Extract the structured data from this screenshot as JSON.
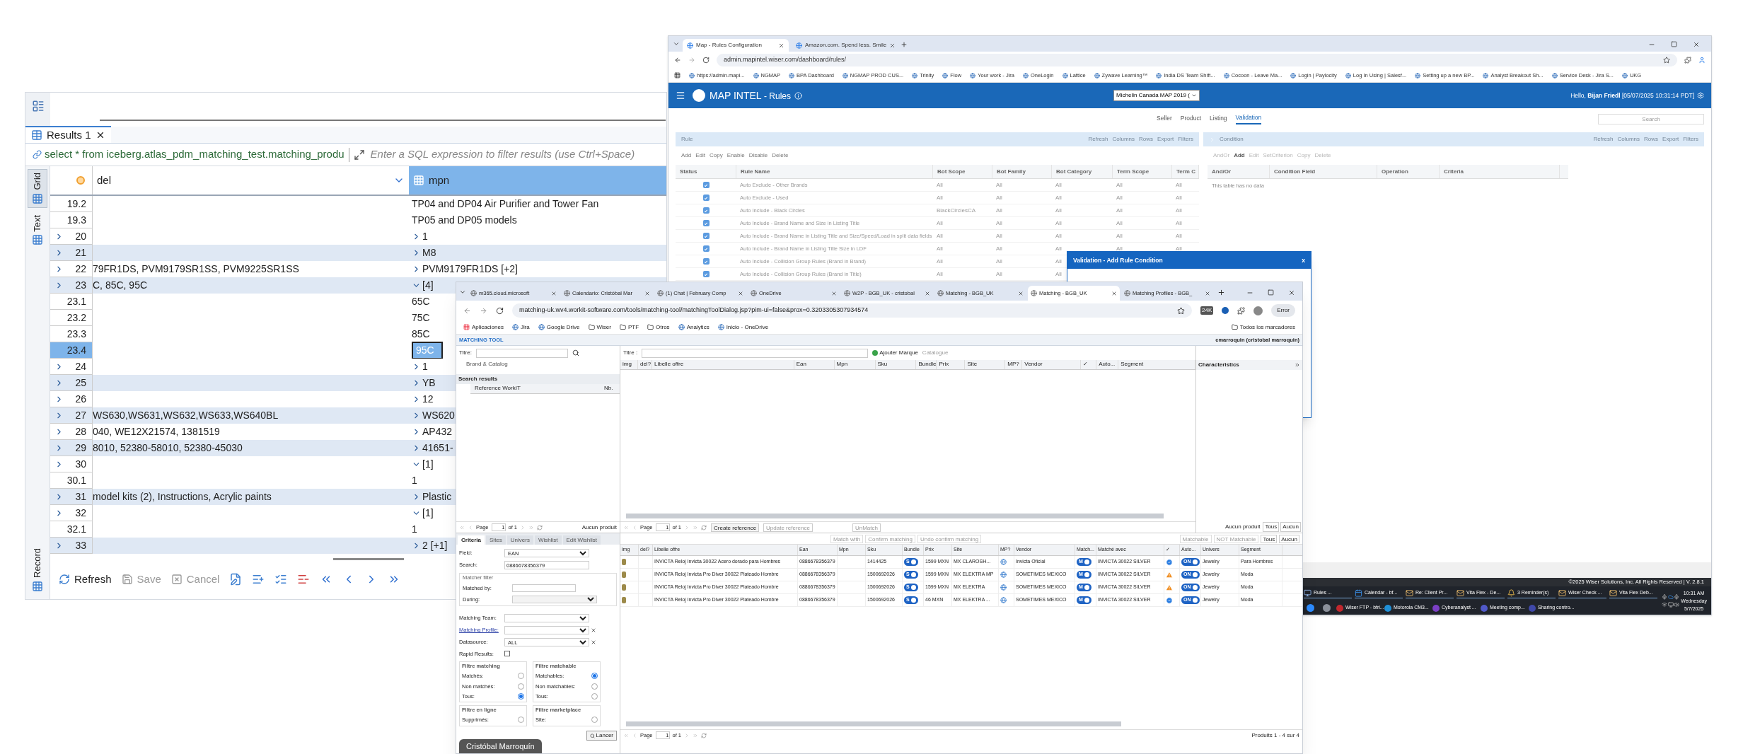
{
  "dbeaver": {
    "results_tab": "Results 1",
    "query": "select * from iceberg.atlas_pdm_matching_test.matching_produ",
    "filter_placeholder": "Enter a SQL expression to filter results (use Ctrl+Space)",
    "side_tabs": [
      {
        "label": "Grid",
        "selected": true
      },
      {
        "label": "Text",
        "selected": false
      },
      {
        "label": "Record",
        "selected": false
      }
    ],
    "columns": [
      {
        "label": "del",
        "selected": false
      },
      {
        "label": "mpn",
        "selected": true
      }
    ],
    "rows": [
      {
        "num": "19.2",
        "mpn": "TP04 and DP04 Air Purifier and Tower Fan",
        "shaded": false,
        "selected": false
      },
      {
        "num": "19.3",
        "mpn": "TP05 and DP05 models",
        "shaded": false,
        "selected": false
      },
      {
        "num": "20",
        "expanded": false,
        "mpn": "1",
        "mpn_expanded": false,
        "shaded": false,
        "selected": false
      },
      {
        "num": "21",
        "expanded": false,
        "mpn": "M8",
        "mpn_expanded": false,
        "shaded": true,
        "selected": false
      },
      {
        "num": "22",
        "expanded": false,
        "model": "79FR1DS, PVM9179SR1SS, PVM9225SR1SS",
        "mpn": "PVM9179FR1DS  [+2]",
        "mpn_expanded": false,
        "shaded": false,
        "selected": false
      },
      {
        "num": "23",
        "expanded": false,
        "model": "C, 85C, 95C",
        "mpn": "[4]",
        "mpn_expanded": true,
        "shaded": true,
        "selected": false
      },
      {
        "num": "23.1",
        "mpn": "65C",
        "shaded": false,
        "selected": false
      },
      {
        "num": "23.2",
        "mpn": "75C",
        "shaded": false,
        "selected": false
      },
      {
        "num": "23.3",
        "mpn": "85C",
        "shaded": false,
        "selected": false
      },
      {
        "num": "23.4",
        "mpn": "95C",
        "shaded": false,
        "selected": true
      },
      {
        "num": "24",
        "expanded": false,
        "mpn": "1",
        "mpn_expanded": false,
        "shaded": false,
        "selected": false
      },
      {
        "num": "25",
        "expanded": false,
        "mpn": "YB",
        "mpn_expanded": false,
        "shaded": true,
        "selected": false
      },
      {
        "num": "26",
        "expanded": false,
        "mpn": "12",
        "mpn_expanded": false,
        "shaded": false,
        "selected": false
      },
      {
        "num": "27",
        "expanded": false,
        "model": "WS630,WS631,WS632,WS633,WS640BL",
        "mpn": "WS620",
        "mpn_expanded": false,
        "shaded": true,
        "selected": false
      },
      {
        "num": "28",
        "expanded": false,
        "model": "040, WE12X21574, 1381519",
        "mpn": "AP432",
        "mpn_expanded": false,
        "shaded": false,
        "selected": false
      },
      {
        "num": "29",
        "expanded": false,
        "model": "8010, 52380-58010, 52380-45030",
        "mpn": "41651-",
        "mpn_expanded": false,
        "shaded": true,
        "selected": false
      },
      {
        "num": "30",
        "expanded": false,
        "mpn": "[1]",
        "mpn_expanded": true,
        "shaded": false,
        "selected": false
      },
      {
        "num": "30.1",
        "mpn": "1",
        "shaded": false,
        "selected": false
      },
      {
        "num": "31",
        "expanded": false,
        "model": "model kits (2), Instructions, Acrylic paints",
        "mpn": "Plastic",
        "mpn_expanded": false,
        "shaded": true,
        "selected": false
      },
      {
        "num": "32",
        "expanded": false,
        "mpn": "[1]",
        "mpn_expanded": true,
        "shaded": false,
        "selected": false
      },
      {
        "num": "32.1",
        "mpn": "1",
        "shaded": false,
        "selected": false
      },
      {
        "num": "33",
        "expanded": false,
        "mpn": "2  [+1]",
        "mpn_expanded": false,
        "shaded": true,
        "selected": false
      }
    ],
    "toolbar": [
      {
        "label": "Refresh",
        "disabled": false
      },
      {
        "label": "Save",
        "disabled": true
      },
      {
        "label": "Cancel",
        "disabled": true
      }
    ]
  },
  "rules_browser": {
    "tabs": [
      {
        "title": "Map - Rules Configuration",
        "selected": true
      },
      {
        "title": "Amazon.com. Spend less. Smile",
        "selected": false
      }
    ],
    "url": "admin.mapintel.wiser.com/dashboard/rules/",
    "bookmarks": [
      "https://admin.mapi...",
      "NGMAP",
      "BPA Dashboard",
      "NGMAP PROD CUS...",
      "Trinity",
      "Flow",
      "Your work - Jira",
      "OneLogin",
      "Lattice",
      "Zywave Learning™",
      "India DS Team Shift...",
      "Cocoon - Leave Ma...",
      "Login | Paylocity",
      "Log In Using | Salesf...",
      "Setting up a new BP...",
      "Analyst Breakout Sh...",
      "Service Desk - Jira S...",
      "UKG"
    ],
    "app_title": "MAP INTEL",
    "page_title": "- Rules",
    "dataset": "Michelin Canada MAP 2019 (",
    "greeting": "Hello, **Bijan Friedl** [05/07/2025 10:31:14 PDT]",
    "nav": [
      {
        "label": "Seller",
        "selected": false
      },
      {
        "label": "Product",
        "selected": false
      },
      {
        "label": "Listing",
        "selected": false
      },
      {
        "label": "Validation",
        "selected": true
      }
    ],
    "search_placeholder": "Search",
    "rule_panel": {
      "title": "Rule",
      "tools": [
        "Refresh",
        "Columns",
        "Rows",
        "Export",
        "Filters"
      ],
      "actions": [
        {
          "label": "Add",
          "disabled": false
        },
        {
          "label": "Edit",
          "disabled": false
        },
        {
          "label": "Copy",
          "disabled": false
        },
        {
          "label": "Enable",
          "disabled": false
        },
        {
          "label": "Disable",
          "disabled": false
        },
        {
          "label": "Delete",
          "disabled": false
        }
      ],
      "status_column": "Status",
      "columns": [
        "Rule Name",
        "Bot Scope",
        "Bot Family",
        "Bot Category",
        "Term Scope",
        "Term C"
      ],
      "rows": [
        {
          "enabled": true,
          "cells": [
            "Auto Exclude - Other Brands",
            "All",
            "All",
            "All",
            "All",
            "All"
          ]
        },
        {
          "enabled": true,
          "cells": [
            "Auto Exclude - Used",
            "All",
            "All",
            "All",
            "All",
            "All"
          ]
        },
        {
          "enabled": true,
          "cells": [
            "Auto Include - Black Circles",
            "BlackCirclesCA",
            "All",
            "All",
            "All",
            "All"
          ]
        },
        {
          "enabled": true,
          "cells": [
            "Auto Include - Brand Name and Size in Listing Title",
            "All",
            "All",
            "All",
            "All",
            "All"
          ]
        },
        {
          "enabled": true,
          "cells": [
            "Auto Include - Brand Name in Listing Title and Size/Speed/Load in split data fields",
            "All",
            "All",
            "All",
            "All",
            "All"
          ]
        },
        {
          "enabled": true,
          "cells": [
            "Auto Include - Brand Name in Listing Title Size in LDF",
            "All",
            "All",
            "All",
            "All",
            "All"
          ]
        },
        {
          "enabled": true,
          "cells": [
            "Auto Include - Collision Group Rules (Brand in Brand)",
            "All",
            "All",
            "All"
          ]
        },
        {
          "enabled": true,
          "cells": [
            "Auto Include - Collision Group Rules (Brand in Title)",
            "All",
            "All",
            "All"
          ]
        }
      ]
    },
    "condition_panel": {
      "title": "Condition",
      "tools": [
        "Refresh",
        "Columns",
        "Rows",
        "Export",
        "Filters"
      ],
      "actions": [
        {
          "label": "AndOr",
          "disabled": true
        },
        {
          "label": "Add",
          "disabled": false
        },
        {
          "label": "Edit",
          "disabled": true
        },
        {
          "label": "SetCriterion",
          "disabled": true
        },
        {
          "label": "Copy",
          "disabled": true
        },
        {
          "label": "Delete",
          "disabled": true
        }
      ],
      "columns": [
        "And/Or",
        "Condition Field",
        "Operation",
        "Criteria"
      ],
      "empty": "This table has no data"
    },
    "dialog_title": "Validation - Add Rule Condition",
    "dialog_close": "x",
    "footer": "©2025 Wiser Solutions, Inc. All Rights Reserved | V. 2.8.1",
    "taskbar": {
      "windows": [
        {
          "label": "Rules ...",
          "kind": "app"
        },
        {
          "label": "Calendar - bf...",
          "kind": "calendar"
        },
        {
          "label": "Re: Client Pr...",
          "kind": "mail"
        },
        {
          "label": "Vita Flex - De...",
          "kind": "mail"
        },
        {
          "label": "3 Reminder(s)",
          "kind": "bell"
        },
        {
          "label": "Wiser Check ...",
          "kind": "mail"
        },
        {
          "label": "Vita Flex Deb...",
          "kind": "mail"
        }
      ],
      "apps": [
        {
          "color": "#2d8cff"
        },
        {
          "color": "#8a8f99"
        },
        {
          "label": "Wiser FTP - bfri...",
          "color": "#c1272d"
        },
        {
          "label": "Motorola CM3...",
          "color": "#1f8fd6"
        },
        {
          "label": "Cyberanalyst ...",
          "color": "#7b3fc4"
        },
        {
          "label": "Meeting comp...",
          "color": "#5059c9"
        },
        {
          "label": "Sharing contro...",
          "color": "#3f48a8"
        }
      ],
      "time": "10:31 AM",
      "day": "Wednesday",
      "date": "5/7/2025"
    }
  },
  "matching_browser": {
    "tabs": [
      {
        "title": "m365.cloud.microsoft",
        "selected": false
      },
      {
        "title": "Calendario: Cristóbal Mar",
        "selected": false
      },
      {
        "title": "(1) Chat | February Comp",
        "selected": false
      },
      {
        "title": "OneDrive",
        "selected": false
      },
      {
        "title": "W2P - BGB_UK - cristobal",
        "selected": false
      },
      {
        "title": "Matching - BGB_UK",
        "selected": false
      },
      {
        "title": "Matching - BGB_UK",
        "selected": true
      },
      {
        "title": "Matching Profiles - BGB_",
        "selected": false
      }
    ],
    "url": "matching-uk.wv4.workit-software.com/tools/matching-tool/matchingToolDialog.jsp?pim-ui=false&prox=0.3203305307934574",
    "profile_button": "Error",
    "extension_badge": "24K",
    "bookmarks": [
      "Aplicaciones",
      "Jira",
      "Google Drive",
      "Wiser",
      "PTF",
      "Otros",
      "Analytics",
      "Inicio - OneDrive"
    ],
    "all_bookmarks": "Todos los marcadores",
    "app_title": "MATCHING TOOL",
    "user": "cmarroquin (cristobal marroquin)",
    "search_pane": {
      "title_label": "Titre:",
      "brand_catalog": "Brand & Catalog",
      "results_title": "Search results",
      "columns": [
        "Reference WorkIT",
        "Nb."
      ]
    },
    "pager_left": {
      "page": "Page",
      "page_value": "1",
      "of": "of 1",
      "status": "Aucun produit"
    },
    "offers_pane": {
      "title_label": "Titre :",
      "add_brand": "Ajouter Marque",
      "catalogue": "Catalogue",
      "columns": [
        "img",
        "del?",
        "Libelle offre",
        "Ean",
        "Mpn",
        "Sku",
        "Bundle",
        "Prix",
        "Site",
        "MP?",
        "Vendor",
        "✓",
        "Auto...",
        "Segment"
      ],
      "characteristics": "Characteristics",
      "pager": {
        "page": "Page",
        "page_value": "1",
        "of": "of 1"
      },
      "actions": [
        {
          "label": "Create reference",
          "disabled": false
        },
        {
          "label": "Update reference",
          "disabled": true
        },
        {
          "label": "UnMatch",
          "disabled": true
        }
      ],
      "status": "Aucun produit",
      "filters": [
        "Tous",
        "Aucun"
      ]
    },
    "criteria_tabs": [
      {
        "label": "Criteria",
        "selected": true
      },
      {
        "label": "Sites",
        "selected": false
      },
      {
        "label": "Univers",
        "selected": false
      },
      {
        "label": "Wishlist",
        "selected": false
      },
      {
        "label": "Edit Wishlist",
        "selected": false
      }
    ],
    "criteria": {
      "field_label": "Field:",
      "field_value": "EAN",
      "search_label": "Search:",
      "search_value": "0886678356379",
      "matcher_filter": "Matcher filter",
      "matched_by": "Matched by:",
      "during": "During:",
      "team": "Matching Team:",
      "profile": "Matching Profile:",
      "datasource": "Datasource:",
      "datasource_value": "ALL",
      "rapid": "Rapid Results:",
      "rapid_checked": false,
      "groups": [
        {
          "title": "Filtre matching",
          "options": [
            {
              "label": "Matchés:",
              "selected": false
            },
            {
              "label": "Non matchés:",
              "selected": false
            },
            {
              "label": "Tous:",
              "selected": true
            }
          ]
        },
        {
          "title": "Filtre matchable",
          "options": [
            {
              "label": "Matchables:",
              "selected": true
            },
            {
              "label": "Non matchables:",
              "selected": false
            },
            {
              "label": "Tous:",
              "selected": false
            }
          ]
        },
        {
          "title": "Filtre en ligne",
          "options": [
            {
              "label": "Supprimés:",
              "selected": false
            }
          ]
        },
        {
          "title": "Filtre marketplace",
          "options": [
            {
              "label": "Site:",
              "selected": false
            }
          ]
        }
      ],
      "launch": "Lancer"
    },
    "results": {
      "actions": [
        {
          "label": "Match with",
          "disabled": true
        },
        {
          "label": "Confirm matching",
          "disabled": true
        },
        {
          "label": "Undo confirm matching",
          "disabled": true
        }
      ],
      "flags": [
        {
          "label": "Matchable",
          "disabled": true
        },
        {
          "label": "NOT Matchable",
          "disabled": true
        }
      ],
      "filters": [
        "Tous",
        "Aucun"
      ],
      "columns": [
        "img",
        "del?",
        "Libelle offre",
        "Ean",
        "Mpn",
        "Sku",
        "Bundle",
        "Prix",
        "Site",
        "MP?",
        "Vendor",
        "Match...",
        "Matché avec",
        "✓",
        "Auto...",
        "Univers",
        "Segment"
      ],
      "rows": [
        {
          "libelle": "INVICTA Reloj Invicta 30022 Acero dorado para Hombres",
          "ean": "0886678356379",
          "sku": "1414425",
          "bundle": {
            "label": "S",
            "on": true
          },
          "prix": "1599 MXN",
          "site": "MX CLAROSH...",
          "vendor": "Invicta Oficial",
          "match": {
            "label": "M",
            "on": true
          },
          "matched_with": "INVICTA 30022 SILVER",
          "warning": false,
          "auto": {
            "label": "ON",
            "on": true
          },
          "univers": "Jewelry",
          "segment": "Para Hombres"
        },
        {
          "libelle": "INVICTA Reloj Invicta Pro Diver 30022 Plateado Hombre",
          "ean": "0886678356379",
          "sku": "1500692026",
          "bundle": {
            "label": "S",
            "on": true
          },
          "prix": "1599 MXN",
          "site": "MX ELEKTRA MP",
          "vendor": "SOMETIMES MEXICO",
          "match": {
            "label": "M",
            "on": true
          },
          "matched_with": "INVICTA 30022 SILVER",
          "warning": true,
          "auto": {
            "label": "ON",
            "on": true
          },
          "univers": "Jewelry",
          "segment": "Moda"
        },
        {
          "libelle": "INVICTA Reloj Invicta Pro Diver 30022 Plateado Hombre",
          "ean": "0886678356379",
          "sku": "1500692026",
          "bundle": {
            "label": "S",
            "on": true
          },
          "prix": "1599 MXN",
          "site": "MX ELEKTRA",
          "vendor": "SOMETIMES MEXICO",
          "match": {
            "label": "M",
            "on": true
          },
          "matched_with": "INVICTA 30022 SILVER",
          "warning": true,
          "auto": {
            "label": "ON",
            "on": true
          },
          "univers": "Jewelry",
          "segment": "Moda"
        },
        {
          "libelle": "INVICTA Reloj Invicta Pro Diver 30022 Plateado Hombre",
          "ean": "0886678356379",
          "sku": "1500692026",
          "bundle": {
            "label": "S",
            "on": true
          },
          "prix": "46 MXN",
          "site": "MX ELEKTRA ...",
          "vendor": "SOMETIMES MEXICO",
          "match": {
            "label": "M",
            "on": true
          },
          "matched_with": "INVICTA 30022 SILVER",
          "warning": false,
          "auto": {
            "label": "ON",
            "on": true
          },
          "univers": "Jewelry",
          "segment": "Moda"
        }
      ],
      "pager": {
        "page": "Page",
        "page_value": "1",
        "of": "of 1"
      },
      "status": "Produits 1 - 4 sur 4"
    },
    "caption": "Cristóbal Marroquín"
  }
}
